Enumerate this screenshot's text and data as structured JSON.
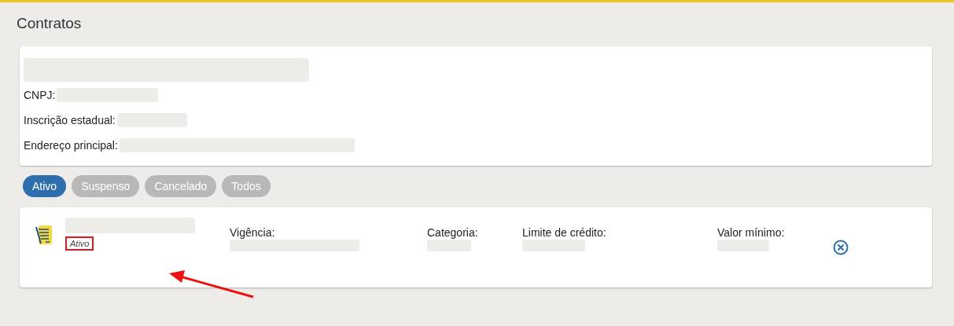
{
  "title": "Contratos",
  "company": {
    "fields": [
      {
        "label": "CNPJ:"
      },
      {
        "label": "Inscrição estadual:"
      },
      {
        "label": "Endereço principal:"
      }
    ]
  },
  "tabs": [
    {
      "label": "Ativo",
      "selected": true
    },
    {
      "label": "Suspenso",
      "selected": false
    },
    {
      "label": "Cancelado",
      "selected": false
    },
    {
      "label": "Todos",
      "selected": false
    }
  ],
  "contracts": [
    {
      "status": "Ativo",
      "status_highlighted": true,
      "fields": [
        {
          "label": "Vigência:"
        },
        {
          "label": "Categoria:"
        },
        {
          "label": "Limite de crédito:"
        },
        {
          "label": "Valor mínimo:"
        }
      ]
    }
  ]
}
